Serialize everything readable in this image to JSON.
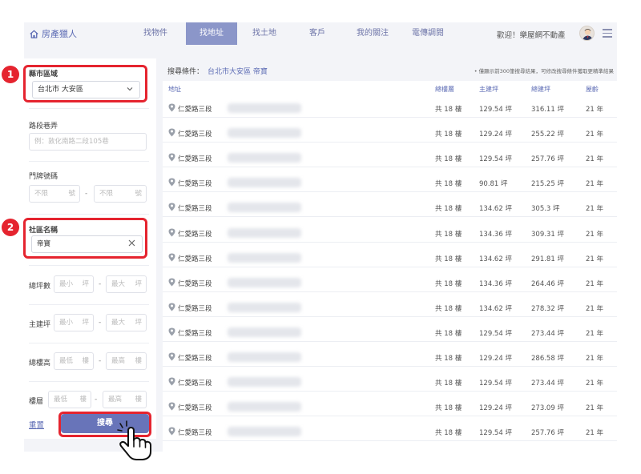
{
  "header": {
    "brand": "房產獵人",
    "tabs": [
      {
        "label": "找物件",
        "active": false
      },
      {
        "label": "找地址",
        "active": true
      },
      {
        "label": "找土地",
        "active": false
      },
      {
        "label": "客戶",
        "active": false
      },
      {
        "label": "我的關注",
        "active": false
      },
      {
        "label": "電傳調閱",
        "active": false
      }
    ],
    "welcome": "歡迎！樂屋網不動產"
  },
  "filters": {
    "city_area": {
      "label": "縣市區域",
      "value": "台北市 大安區"
    },
    "road": {
      "label": "路段巷弄",
      "placeholder": "例：敦化南路二段105巷"
    },
    "door_number": {
      "label": "門牌號碼",
      "from_placeholder": "不限",
      "to_placeholder": "不限",
      "unit": "號"
    },
    "community": {
      "label": "社區名稱",
      "value": "帝寶"
    },
    "total_area": {
      "label": "總坪數",
      "min_placeholder": "最小",
      "max_placeholder": "最大",
      "unit": "坪"
    },
    "main_area": {
      "label": "主建坪",
      "min_placeholder": "最小",
      "max_placeholder": "最大",
      "unit": "坪"
    },
    "total_floors": {
      "label": "總樓高",
      "min_placeholder": "最低",
      "max_placeholder": "最高",
      "unit": "樓"
    },
    "floor": {
      "label": "樓層",
      "min_placeholder": "最低",
      "max_placeholder": "最高",
      "unit": "樓"
    },
    "range_sep": "-",
    "reset_label": "重置",
    "search_label": "搜尋"
  },
  "annotations": {
    "badge1": "1",
    "badge2": "2"
  },
  "results": {
    "condition_label": "搜尋條件：",
    "condition_value": "台北市大安區 帝寶",
    "note": "• 僅顯示前300筆搜尋結果，可修改搜尋條件獲取更精準結果",
    "columns": {
      "address": "地址",
      "total_floors": "總樓層",
      "main_area": "主建坪",
      "total_area": "總建坪",
      "age": "屋齡"
    },
    "rows": [
      {
        "address": "仁愛路三段",
        "floors": "共 18 樓",
        "main": "129.54 坪",
        "total": "316.11 坪",
        "age": "21 年"
      },
      {
        "address": "仁愛路三段",
        "floors": "共 18 樓",
        "main": "129.24 坪",
        "total": "255.22 坪",
        "age": "21 年"
      },
      {
        "address": "仁愛路三段",
        "floors": "共 18 樓",
        "main": "129.54 坪",
        "total": "257.76 坪",
        "age": "21 年"
      },
      {
        "address": "仁愛路三段",
        "floors": "共 18 樓",
        "main": "90.81 坪",
        "total": "215.25 坪",
        "age": "21 年"
      },
      {
        "address": "仁愛路三段",
        "floors": "共 18 樓",
        "main": "134.62 坪",
        "total": "305.3 坪",
        "age": "21 年"
      },
      {
        "address": "仁愛路三段",
        "floors": "共 18 樓",
        "main": "134.36 坪",
        "total": "309.31 坪",
        "age": "21 年"
      },
      {
        "address": "仁愛路三段",
        "floors": "共 18 樓",
        "main": "134.62 坪",
        "total": "291.81 坪",
        "age": "21 年"
      },
      {
        "address": "仁愛路三段",
        "floors": "共 18 樓",
        "main": "134.36 坪",
        "total": "264.46 坪",
        "age": "21 年"
      },
      {
        "address": "仁愛路三段",
        "floors": "共 18 樓",
        "main": "134.62 坪",
        "total": "278.32 坪",
        "age": "21 年"
      },
      {
        "address": "仁愛路三段",
        "floors": "共 18 樓",
        "main": "129.54 坪",
        "total": "273.44 坪",
        "age": "21 年"
      },
      {
        "address": "仁愛路三段",
        "floors": "共 18 樓",
        "main": "129.24 坪",
        "total": "286.58 坪",
        "age": "21 年"
      },
      {
        "address": "仁愛路三段",
        "floors": "共 18 樓",
        "main": "129.54 坪",
        "total": "273.44 坪",
        "age": "21 年"
      },
      {
        "address": "仁愛路三段",
        "floors": "共 18 樓",
        "main": "129.24 坪",
        "total": "273.09 坪",
        "age": "21 年"
      },
      {
        "address": "仁愛路三段",
        "floors": "共 18 樓",
        "main": "129.54 坪",
        "total": "257.76 坪",
        "age": "21 年"
      }
    ]
  },
  "colors": {
    "brand": "#5c6bb4",
    "active_tab": "#8b96c9",
    "search_button": "#6874b9",
    "highlight": "#e5242f"
  }
}
